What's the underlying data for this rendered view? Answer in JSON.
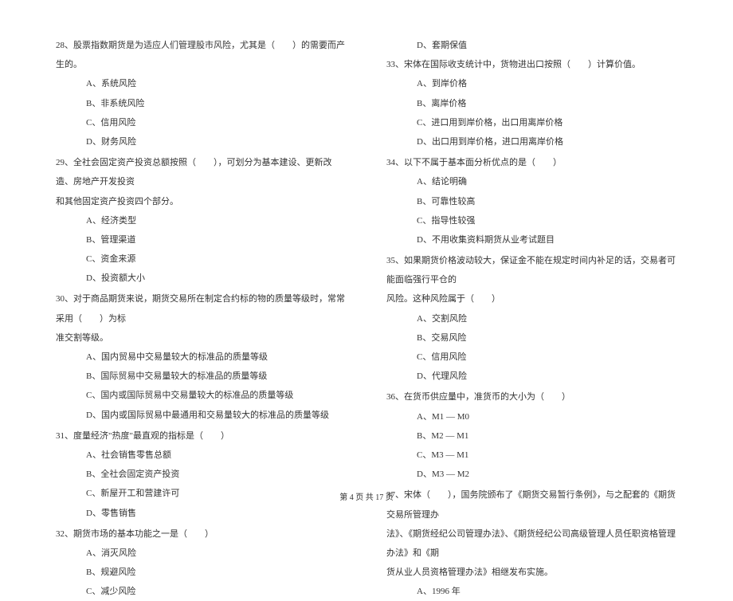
{
  "left_column": {
    "q28": {
      "text": "28、股票指数期货是为适应人们管理股市风险，尤其是（　　）的需要而产生的。",
      "options": {
        "a": "A、系统风险",
        "b": "B、非系统风险",
        "c": "C、信用风险",
        "d": "D、财务风险"
      }
    },
    "q29": {
      "text": "29、全社会固定资产投资总额按照（　　），可划分为基本建设、更新改造、房地产开发投资",
      "cont": "和其他固定资产投资四个部分。",
      "options": {
        "a": "A、经济类型",
        "b": "B、管理渠道",
        "c": "C、资金来源",
        "d": "D、投资额大小"
      }
    },
    "q30": {
      "text": "30、对于商品期货来说，期货交易所在制定合约标的物的质量等级时，常常采用（　　）为标",
      "cont": "准交割等级。",
      "options": {
        "a": "A、国内贸易中交易量较大的标准品的质量等级",
        "b": "B、国际贸易中交易量较大的标准品的质量等级",
        "c": "C、国内或国际贸易中交易量较大的标准品的质量等级",
        "d": "D、国内或国际贸易中最通用和交易量较大的标准品的质量等级"
      }
    },
    "q31": {
      "text": "31、度量经济\"热度\"最直观的指标是（　　）",
      "options": {
        "a": "A、社会销售零售总额",
        "b": "B、全社会固定资产投资",
        "c": "C、新屋开工和营建许可",
        "d": "D、零售销售"
      }
    },
    "q32": {
      "text": "32、期货市场的基本功能之一是（　　）",
      "options": {
        "a": "A、消灭风险",
        "b": "B、规避风险",
        "c": "C、减少风险"
      }
    }
  },
  "right_column": {
    "q32d": "D、套期保值",
    "q33": {
      "text": "33、宋体在国际收支统计中，货物进出口按照（　　）计算价值。",
      "options": {
        "a": "A、到岸价格",
        "b": "B、离岸价格",
        "c": "C、进口用到岸价格，出口用离岸价格",
        "d": "D、出口用到岸价格，进口用离岸价格"
      }
    },
    "q34": {
      "text": "34、以下不属于基本面分析优点的是（　　）",
      "options": {
        "a": "A、结论明确",
        "b": "B、可靠性较高",
        "c": "C、指导性较强",
        "d": "D、不用收集资料期货从业考试题目"
      }
    },
    "q35": {
      "text": "35、如果期货价格波动较大，保证金不能在规定时间内补足的话，交易者可能面临强行平仓的",
      "cont": "风险。这种风险属于（　　）",
      "options": {
        "a": "A、交割风险",
        "b": "B、交易风险",
        "c": "C、信用风险",
        "d": "D、代理风险"
      }
    },
    "q36": {
      "text": "36、在货币供应量中，准货币的大小为（　　）",
      "options": {
        "a": "A、M1 — M0",
        "b": "B、M2 — M1",
        "c": "C、M3 — M1",
        "d": "D、M3 — M2"
      }
    },
    "q37": {
      "text": "37、宋体（　　），国务院颁布了《期货交易暂行条例》，与之配套的《期货交易所管理办",
      "cont1": "法》、《期货经纪公司管理办法》、《期货经纪公司高级管理人员任职资格管理办法》和《期",
      "cont2": "货从业人员资格管理办法》相继发布实施。",
      "options": {
        "a": "A、1996 年"
      }
    }
  },
  "footer": "第 4 页 共 17 页"
}
